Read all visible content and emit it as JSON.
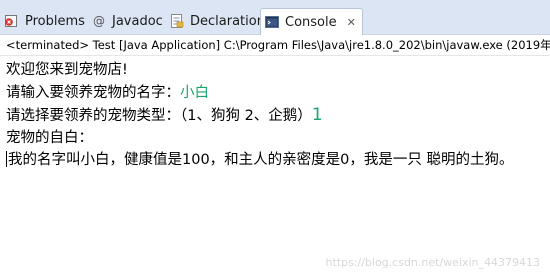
{
  "tabs": [
    {
      "label": "Problems",
      "icon": "problems-icon"
    },
    {
      "label": "Javadoc",
      "icon": "javadoc-icon"
    },
    {
      "label": "Declaration",
      "icon": "declaration-icon"
    },
    {
      "label": "Console",
      "icon": "console-icon",
      "active": true,
      "close": "✕"
    }
  ],
  "console": {
    "status": "<terminated> Test [Java Application] C:\\Program Files\\Java\\jre1.8.0_202\\bin\\javaw.exe (2019年",
    "lines": {
      "l1": "欢迎您来到宠物店!",
      "l2_prompt": "请输入要领养宠物的名字：",
      "l2_input": "小白",
      "l3_prompt": "请选择要领养的宠物类型：（1、狗狗 2、企鹅）",
      "l3_input": "1",
      "l4": "宠物的自白：",
      "l5": "我的名字叫小白，健康值是100，和主人的亲密度是0，我是一只 聪明的土狗。"
    }
  },
  "watermark": "https://blog.csdn.net/weixin_44379413"
}
